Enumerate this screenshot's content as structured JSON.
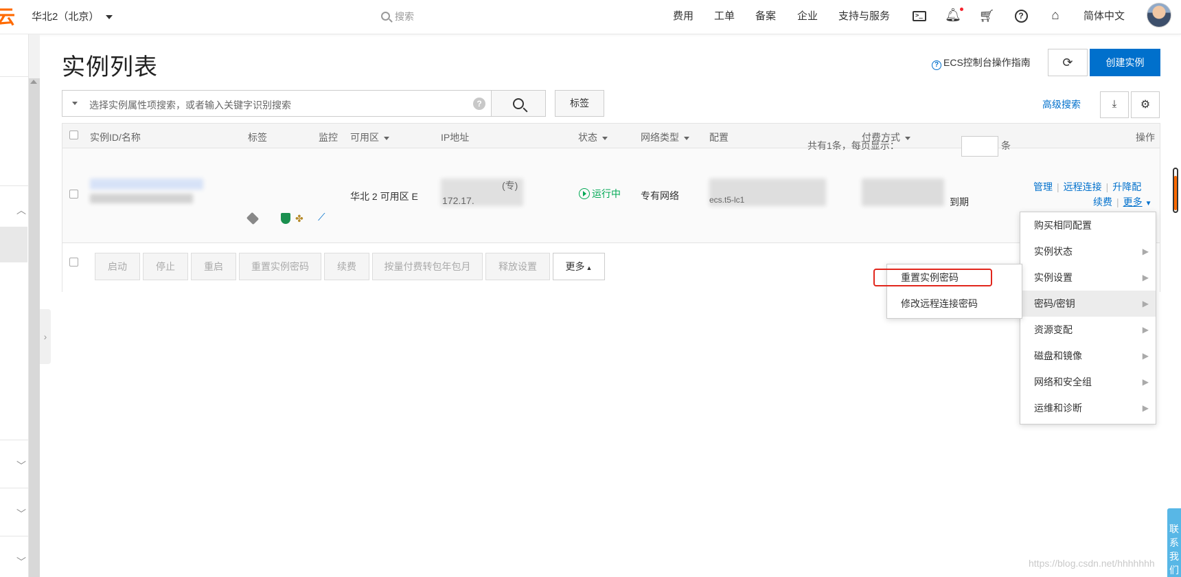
{
  "topbar": {
    "logo_fragment": "云",
    "region": "华北2（北京）",
    "search_placeholder": "搜索",
    "nav": [
      "费用",
      "工单",
      "备案",
      "企业",
      "支持与服务"
    ],
    "language": "简体中文",
    "icons": [
      "terminal-icon",
      "bell-icon",
      "cart-icon",
      "help-icon",
      "home-icon"
    ]
  },
  "page": {
    "title": "实例列表",
    "guide_link": "ECS控制台操作指南",
    "refresh_icon": "⟳",
    "create_button": "创建实例"
  },
  "search": {
    "placeholder": "选择实例属性项搜索，或者输入关键字识别搜索",
    "help": "?",
    "tag_button": "标签",
    "advanced": "高级搜索"
  },
  "table": {
    "headers": [
      "实例ID/名称",
      "标签",
      "监控",
      "可用区",
      "IP地址",
      "状态",
      "网络类型",
      "配置",
      "付费方式",
      "操作"
    ],
    "row": {
      "zone": "华北 2 可用区 E",
      "ip_fragment_1": "(专)",
      "ip_fragment_2": "172.17.",
      "status": "运行中",
      "network": "专有网络",
      "config_fragment": "ecs.t5-lc1",
      "expire_suffix": "到期",
      "actions": {
        "manage": "管理",
        "remote": "远程连接",
        "upgrade": "升降配",
        "renew": "续费",
        "more": "更多"
      }
    },
    "footer_buttons": [
      "启动",
      "停止",
      "重启",
      "重置实例密码",
      "续费",
      "按量付费转包年包月",
      "释放设置"
    ],
    "footer_more": "更多",
    "pager_text": "共有1条，每页显示：",
    "pager_unit": "条"
  },
  "more_menu": {
    "items": [
      {
        "label": "购买相同配置",
        "has_sub": false
      },
      {
        "label": "实例状态",
        "has_sub": true
      },
      {
        "label": "实例设置",
        "has_sub": true
      },
      {
        "label": "密码/密钥",
        "has_sub": true
      },
      {
        "label": "资源变配",
        "has_sub": true
      },
      {
        "label": "磁盘和镜像",
        "has_sub": true
      },
      {
        "label": "网络和安全组",
        "has_sub": true
      },
      {
        "label": "运维和诊断",
        "has_sub": true
      }
    ],
    "submenu": [
      "重置实例密码",
      "修改远程连接密码"
    ]
  },
  "contact": "联系我们",
  "watermark": "https://blog.csdn.net/hhhhhhh",
  "colors": {
    "brand": "#ff6a00",
    "primary": "#0070cc",
    "running": "#00a854",
    "highlight": "#e1251b"
  }
}
